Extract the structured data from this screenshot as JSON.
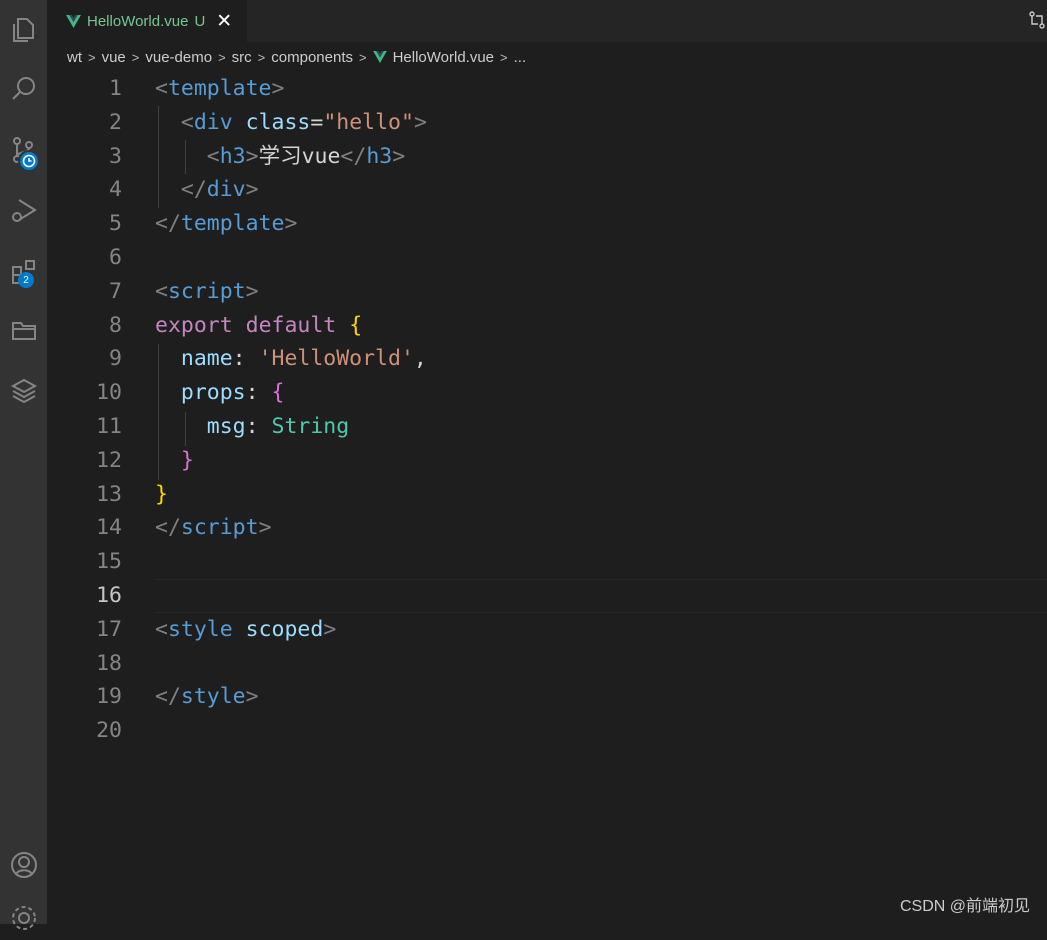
{
  "tab": {
    "title": "HelloWorld.vue",
    "status": "U",
    "close_glyph": "✕"
  },
  "breadcrumb": [
    "wt",
    "vue",
    "vue-demo",
    "src",
    "components",
    "HelloWorld.vue",
    "..."
  ],
  "activity_badge": "2",
  "editor": {
    "active_line": 16,
    "lines": [
      {
        "n": "1",
        "tokens": [
          [
            "t-punct",
            "<"
          ],
          [
            "t-tag",
            "template"
          ],
          [
            "t-punct",
            ">"
          ]
        ]
      },
      {
        "n": "2",
        "tokens": [
          [
            "t-text",
            "  "
          ],
          [
            "t-punct",
            "<"
          ],
          [
            "t-tag",
            "div"
          ],
          [
            "t-text",
            " "
          ],
          [
            "t-attr",
            "class"
          ],
          [
            "t-text",
            "="
          ],
          [
            "t-str",
            "\"hello\""
          ],
          [
            "t-punct",
            ">"
          ]
        ]
      },
      {
        "n": "3",
        "tokens": [
          [
            "t-text",
            "    "
          ],
          [
            "t-punct",
            "<"
          ],
          [
            "t-tag",
            "h3"
          ],
          [
            "t-punct",
            ">"
          ],
          [
            "t-text",
            "学习vue"
          ],
          [
            "t-punct",
            "</"
          ],
          [
            "t-tag",
            "h3"
          ],
          [
            "t-punct",
            ">"
          ]
        ]
      },
      {
        "n": "4",
        "tokens": [
          [
            "t-text",
            "  "
          ],
          [
            "t-punct",
            "</"
          ],
          [
            "t-tag",
            "div"
          ],
          [
            "t-punct",
            ">"
          ]
        ]
      },
      {
        "n": "5",
        "tokens": [
          [
            "t-punct",
            "</"
          ],
          [
            "t-tag",
            "template"
          ],
          [
            "t-punct",
            ">"
          ]
        ]
      },
      {
        "n": "6",
        "tokens": []
      },
      {
        "n": "7",
        "tokens": [
          [
            "t-punct",
            "<"
          ],
          [
            "t-tag",
            "script"
          ],
          [
            "t-punct",
            ">"
          ]
        ]
      },
      {
        "n": "8",
        "tokens": [
          [
            "t-kw",
            "export"
          ],
          [
            "t-text",
            " "
          ],
          [
            "t-kw",
            "default"
          ],
          [
            "t-text",
            " "
          ],
          [
            "t-b1",
            "{"
          ]
        ]
      },
      {
        "n": "9",
        "tokens": [
          [
            "t-text",
            "  "
          ],
          [
            "t-prop",
            "name"
          ],
          [
            "t-text",
            ": "
          ],
          [
            "t-str",
            "'HelloWorld'"
          ],
          [
            "t-text",
            ","
          ]
        ]
      },
      {
        "n": "10",
        "tokens": [
          [
            "t-text",
            "  "
          ],
          [
            "t-prop",
            "props"
          ],
          [
            "t-text",
            ": "
          ],
          [
            "t-b2",
            "{"
          ]
        ]
      },
      {
        "n": "11",
        "tokens": [
          [
            "t-text",
            "    "
          ],
          [
            "t-prop",
            "msg"
          ],
          [
            "t-text",
            ": "
          ],
          [
            "t-type",
            "String"
          ]
        ]
      },
      {
        "n": "12",
        "tokens": [
          [
            "t-text",
            "  "
          ],
          [
            "t-b2",
            "}"
          ]
        ]
      },
      {
        "n": "13",
        "tokens": [
          [
            "t-b1",
            "}"
          ]
        ]
      },
      {
        "n": "14",
        "tokens": [
          [
            "t-punct",
            "</"
          ],
          [
            "t-tag",
            "script"
          ],
          [
            "t-punct",
            ">"
          ]
        ]
      },
      {
        "n": "15",
        "tokens": []
      },
      {
        "n": "16",
        "tokens": []
      },
      {
        "n": "17",
        "tokens": [
          [
            "t-punct",
            "<"
          ],
          [
            "t-tag",
            "style"
          ],
          [
            "t-text",
            " "
          ],
          [
            "t-attr",
            "scoped"
          ],
          [
            "t-punct",
            ">"
          ]
        ]
      },
      {
        "n": "18",
        "tokens": []
      },
      {
        "n": "19",
        "tokens": [
          [
            "t-punct",
            "</"
          ],
          [
            "t-tag",
            "style"
          ],
          [
            "t-punct",
            ">"
          ]
        ]
      },
      {
        "n": "20",
        "tokens": []
      }
    ]
  },
  "watermark": "CSDN @前端初见",
  "icons": [
    "explorer-icon",
    "search-icon",
    "source-control-icon",
    "run-debug-icon",
    "extensions-icon",
    "folder-icon",
    "layers-icon",
    "account-icon",
    "settings-icon",
    "compare-changes-icon",
    "vue-file-icon"
  ]
}
